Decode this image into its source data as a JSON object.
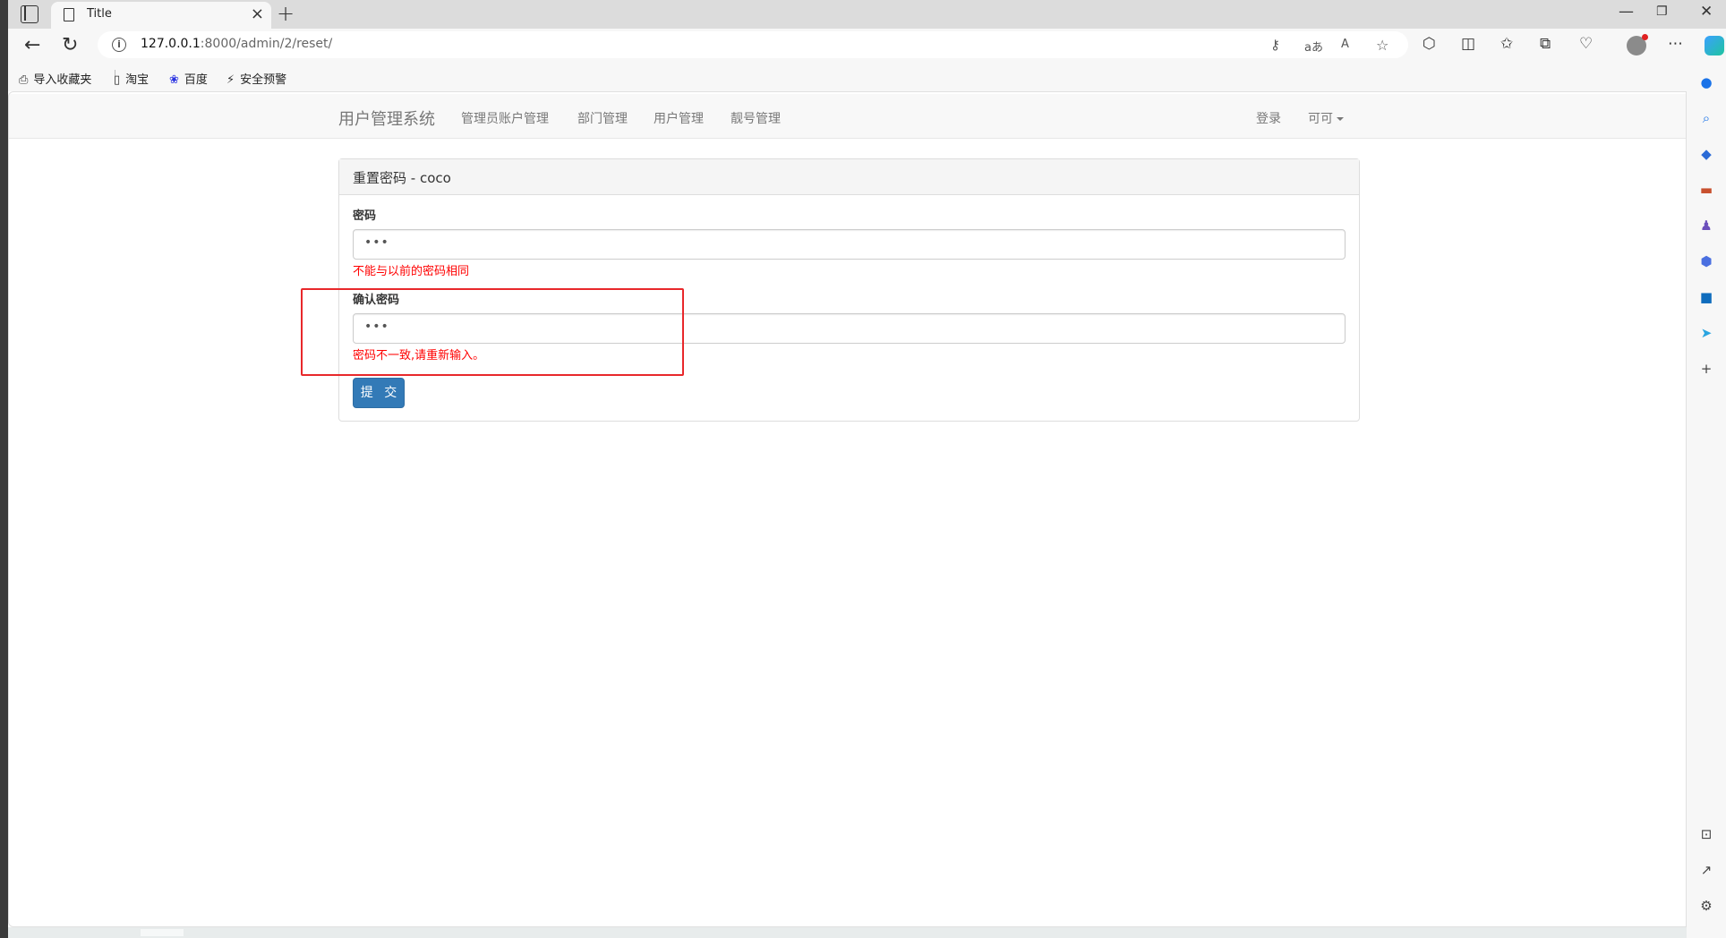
{
  "browser": {
    "tab": {
      "title": "Title"
    },
    "url": {
      "host": "127.0.0.1",
      "rest": ":8000/admin/2/reset/"
    },
    "favorites": [
      {
        "label": "导入收藏夹",
        "icon": "import-favorites-icon"
      },
      {
        "label": "淘宝",
        "icon": "page-icon"
      },
      {
        "label": "百度",
        "icon": "baidu-paw-icon"
      },
      {
        "label": "安全预警",
        "icon": "shield-warning-icon"
      }
    ],
    "window_controls": {
      "minimize": "—",
      "restore": "❐",
      "close": "✕"
    }
  },
  "navbar": {
    "brand": "用户管理系统",
    "links": [
      "管理员账户管理",
      "部门管理",
      "用户管理",
      "靓号管理"
    ],
    "login": "登录",
    "user": "可可"
  },
  "panel": {
    "heading": "重置密码 - coco",
    "fields": [
      {
        "label": "密码",
        "value": "•••",
        "error": "不能与以前的密码相同"
      },
      {
        "label": "确认密码",
        "value": "•••",
        "error": "密码不一致,请重新输入。"
      }
    ],
    "submit": "提 交"
  },
  "colors": {
    "primary_button": "#337ab7",
    "error_text": "#ff0000",
    "annotation_box": "#e8282b"
  }
}
